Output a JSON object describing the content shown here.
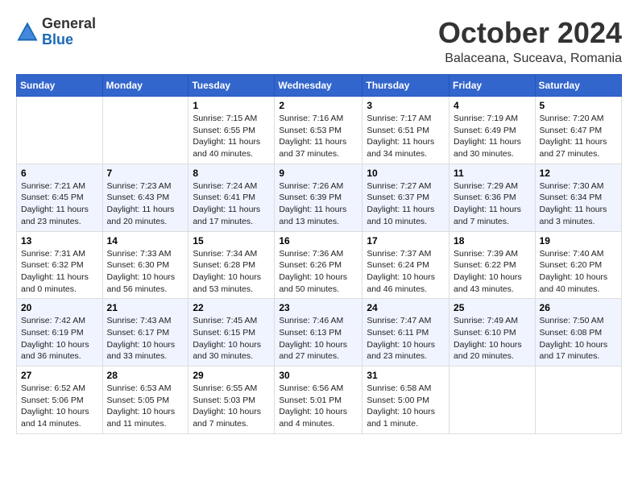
{
  "header": {
    "logo": {
      "general": "General",
      "blue": "Blue"
    },
    "title": "October 2024",
    "location": "Balaceana, Suceava, Romania"
  },
  "weekdays": [
    "Sunday",
    "Monday",
    "Tuesday",
    "Wednesday",
    "Thursday",
    "Friday",
    "Saturday"
  ],
  "weeks": [
    [
      {
        "day": "",
        "content": ""
      },
      {
        "day": "",
        "content": ""
      },
      {
        "day": "1",
        "content": "Sunrise: 7:15 AM\nSunset: 6:55 PM\nDaylight: 11 hours and 40 minutes."
      },
      {
        "day": "2",
        "content": "Sunrise: 7:16 AM\nSunset: 6:53 PM\nDaylight: 11 hours and 37 minutes."
      },
      {
        "day": "3",
        "content": "Sunrise: 7:17 AM\nSunset: 6:51 PM\nDaylight: 11 hours and 34 minutes."
      },
      {
        "day": "4",
        "content": "Sunrise: 7:19 AM\nSunset: 6:49 PM\nDaylight: 11 hours and 30 minutes."
      },
      {
        "day": "5",
        "content": "Sunrise: 7:20 AM\nSunset: 6:47 PM\nDaylight: 11 hours and 27 minutes."
      }
    ],
    [
      {
        "day": "6",
        "content": "Sunrise: 7:21 AM\nSunset: 6:45 PM\nDaylight: 11 hours and 23 minutes."
      },
      {
        "day": "7",
        "content": "Sunrise: 7:23 AM\nSunset: 6:43 PM\nDaylight: 11 hours and 20 minutes."
      },
      {
        "day": "8",
        "content": "Sunrise: 7:24 AM\nSunset: 6:41 PM\nDaylight: 11 hours and 17 minutes."
      },
      {
        "day": "9",
        "content": "Sunrise: 7:26 AM\nSunset: 6:39 PM\nDaylight: 11 hours and 13 minutes."
      },
      {
        "day": "10",
        "content": "Sunrise: 7:27 AM\nSunset: 6:37 PM\nDaylight: 11 hours and 10 minutes."
      },
      {
        "day": "11",
        "content": "Sunrise: 7:29 AM\nSunset: 6:36 PM\nDaylight: 11 hours and 7 minutes."
      },
      {
        "day": "12",
        "content": "Sunrise: 7:30 AM\nSunset: 6:34 PM\nDaylight: 11 hours and 3 minutes."
      }
    ],
    [
      {
        "day": "13",
        "content": "Sunrise: 7:31 AM\nSunset: 6:32 PM\nDaylight: 11 hours and 0 minutes."
      },
      {
        "day": "14",
        "content": "Sunrise: 7:33 AM\nSunset: 6:30 PM\nDaylight: 10 hours and 56 minutes."
      },
      {
        "day": "15",
        "content": "Sunrise: 7:34 AM\nSunset: 6:28 PM\nDaylight: 10 hours and 53 minutes."
      },
      {
        "day": "16",
        "content": "Sunrise: 7:36 AM\nSunset: 6:26 PM\nDaylight: 10 hours and 50 minutes."
      },
      {
        "day": "17",
        "content": "Sunrise: 7:37 AM\nSunset: 6:24 PM\nDaylight: 10 hours and 46 minutes."
      },
      {
        "day": "18",
        "content": "Sunrise: 7:39 AM\nSunset: 6:22 PM\nDaylight: 10 hours and 43 minutes."
      },
      {
        "day": "19",
        "content": "Sunrise: 7:40 AM\nSunset: 6:20 PM\nDaylight: 10 hours and 40 minutes."
      }
    ],
    [
      {
        "day": "20",
        "content": "Sunrise: 7:42 AM\nSunset: 6:19 PM\nDaylight: 10 hours and 36 minutes."
      },
      {
        "day": "21",
        "content": "Sunrise: 7:43 AM\nSunset: 6:17 PM\nDaylight: 10 hours and 33 minutes."
      },
      {
        "day": "22",
        "content": "Sunrise: 7:45 AM\nSunset: 6:15 PM\nDaylight: 10 hours and 30 minutes."
      },
      {
        "day": "23",
        "content": "Sunrise: 7:46 AM\nSunset: 6:13 PM\nDaylight: 10 hours and 27 minutes."
      },
      {
        "day": "24",
        "content": "Sunrise: 7:47 AM\nSunset: 6:11 PM\nDaylight: 10 hours and 23 minutes."
      },
      {
        "day": "25",
        "content": "Sunrise: 7:49 AM\nSunset: 6:10 PM\nDaylight: 10 hours and 20 minutes."
      },
      {
        "day": "26",
        "content": "Sunrise: 7:50 AM\nSunset: 6:08 PM\nDaylight: 10 hours and 17 minutes."
      }
    ],
    [
      {
        "day": "27",
        "content": "Sunrise: 6:52 AM\nSunset: 5:06 PM\nDaylight: 10 hours and 14 minutes."
      },
      {
        "day": "28",
        "content": "Sunrise: 6:53 AM\nSunset: 5:05 PM\nDaylight: 10 hours and 11 minutes."
      },
      {
        "day": "29",
        "content": "Sunrise: 6:55 AM\nSunset: 5:03 PM\nDaylight: 10 hours and 7 minutes."
      },
      {
        "day": "30",
        "content": "Sunrise: 6:56 AM\nSunset: 5:01 PM\nDaylight: 10 hours and 4 minutes."
      },
      {
        "day": "31",
        "content": "Sunrise: 6:58 AM\nSunset: 5:00 PM\nDaylight: 10 hours and 1 minute."
      },
      {
        "day": "",
        "content": ""
      },
      {
        "day": "",
        "content": ""
      }
    ]
  ]
}
